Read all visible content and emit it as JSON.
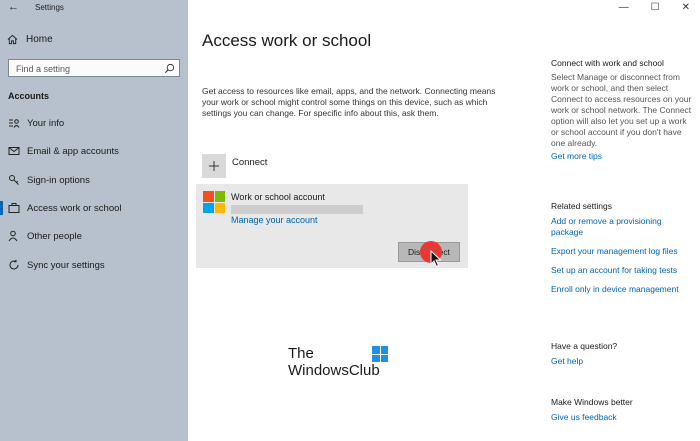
{
  "window": {
    "app_title": "Settings",
    "minimize_glyph": "—",
    "maximize_glyph": "☐",
    "close_glyph": "✕",
    "back_glyph": "←"
  },
  "sidebar": {
    "home_label": "Home",
    "search_placeholder": "Find a setting",
    "section_title": "Accounts",
    "items": [
      {
        "label": "Your info",
        "icon": "person-card-icon"
      },
      {
        "label": "Email & app accounts",
        "icon": "envelope-icon"
      },
      {
        "label": "Sign-in options",
        "icon": "key-icon"
      },
      {
        "label": "Access work or school",
        "icon": "briefcase-icon",
        "selected": true
      },
      {
        "label": "Other people",
        "icon": "person-add-icon"
      },
      {
        "label": "Sync your settings",
        "icon": "sync-icon"
      }
    ]
  },
  "main": {
    "title": "Access work or school",
    "description": "Get access to resources like email, apps, and the network. Connecting means your work or school might control some things on this device, such as which settings you can change. For specific info about this, ask them.",
    "connect_label": "Connect",
    "account": {
      "name": "Work or school account",
      "manage_link": "Manage your account",
      "disconnect_label": "Disconnect"
    },
    "watermark": {
      "line1": "The",
      "line2": "WindowsClub"
    }
  },
  "right": {
    "connect_heading": "Connect with work and school",
    "connect_text": "Select Manage or disconnect from work or school, and then select Connect to access resources on your work or school network. The Connect option will also let you set up a work or school account if you don't have one already.",
    "more_tips": "Get more tips",
    "related_heading": "Related settings",
    "related_links": [
      "Add or remove a provisioning package",
      "Export your management log files",
      "Set up an account for taking tests",
      "Enroll only in device management"
    ],
    "question_heading": "Have a question?",
    "get_help": "Get help",
    "better_heading": "Make Windows better",
    "feedback": "Give us feedback"
  },
  "colors": {
    "accent": "#0063b1",
    "sidebar_bg": "#b6c1cd",
    "click_marker": "#e53935"
  }
}
